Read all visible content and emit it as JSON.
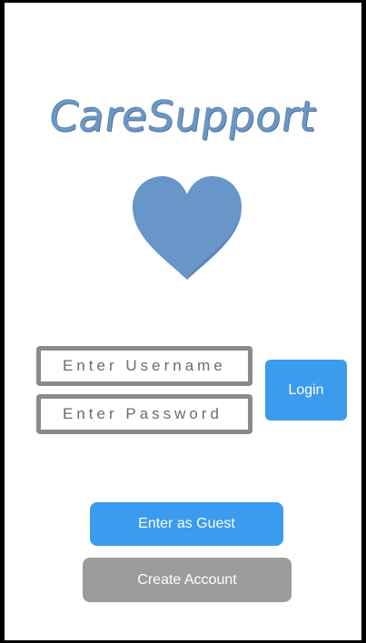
{
  "app": {
    "title": "CareSupport"
  },
  "logo": {
    "icon": "heart-icon"
  },
  "login_form": {
    "username_placeholder": "Enter Username",
    "username_value": "",
    "password_placeholder": "Enter Password",
    "password_value": "",
    "login_label": "Login"
  },
  "actions": {
    "guest_label": "Enter as Guest",
    "create_account_label": "Create Account"
  },
  "colors": {
    "brand": "#6a97c6",
    "heart": "#6896c9",
    "primary_button": "#3a9bef",
    "secondary_button": "#9c9c9c",
    "field_border": "#8a8a8a"
  }
}
